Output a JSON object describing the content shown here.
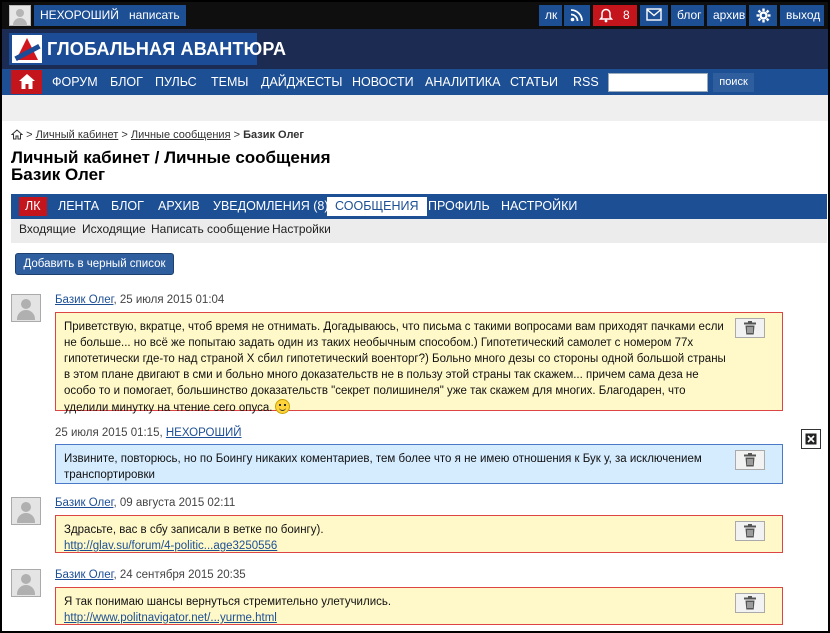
{
  "topbar": {
    "user_name": "НЕХОРОШИЙ",
    "write_label": "написать",
    "lk_label": "лк",
    "notifications_count": "8",
    "blog_label": "блог",
    "archive_label": "архив",
    "exit_label": "выход"
  },
  "logo": {
    "text": "ГЛОБАЛЬНАЯ АВАНТЮРА"
  },
  "main_nav": {
    "items": [
      "ФОРУМ",
      "БЛОГ",
      "ПУЛЬС",
      "ТЕМЫ",
      "ДАЙДЖЕСТЫ",
      "НОВОСТИ",
      "АНАЛИТИКА",
      "СТАТЬИ",
      "RSS"
    ],
    "search_value": "",
    "search_button": "поиск"
  },
  "breadcrumb": {
    "sep": ">",
    "link1": "Личный кабинет",
    "link2": "Личные сообщения",
    "current": "Базик Олег"
  },
  "page_title": "Личный кабинет / Личные сообщения",
  "page_subtitle": "Базик Олег",
  "cabinet_nav": {
    "items": [
      "ЛК",
      "ЛЕНТА",
      "БЛОГ",
      "АРХИВ",
      "УВЕДОМЛЕНИЯ (8)",
      "СООБЩЕНИЯ",
      "ПРОФИЛЬ",
      "НАСТРОЙКИ"
    ]
  },
  "sub_nav": {
    "items": [
      "Входящие",
      "Исходящие",
      "Написать сообщение",
      "Настройки"
    ]
  },
  "blacklist_button": "Добавить в черный список",
  "messages": [
    {
      "author": "Базик Олег",
      "date": ", 25 июля 2015 01:04",
      "text": "Приветствую, вкратце, чтоб время не отнимать. Догадываюсь, что письма с такими вопросами вам приходят пачками если не больше... но всё же попытаю задать один из таких необычным способом.) Гипотетический самолет с номером 77х гипотетически где-то над страной Х сбил гипотетический военторг?) Больно много дезы со стороны одной большой страны в этом плане двигают в сми и больно много доказательств не в пользу этой страны так скажем... причем сама деза не особо то и помогает, большинство доказательств \"секрет полишинеля\" уже так скажем для многих. Благодарен, что уделили минутку на чтение сего опуса."
    },
    {
      "author": "НЕХОРОШИЙ",
      "date": "25 июля 2015 01:15, ",
      "text": "Извините, повторюсь, но по Боингу никаких коментариев, тем более что я не имею отношения к Бук у, за исключением транспортировки"
    },
    {
      "author": "Базик Олег",
      "date": ", 09 августа 2015 02:11",
      "text": "Здрасьте, вас в сбу записали в ветке по боингу).",
      "link": "http://glav.su/forum/4-politic...age3250556"
    },
    {
      "author": "Базик Олег",
      "date": ", 24 сентября 2015 20:35",
      "text": "Я так понимаю шансы вернуться стремительно улетучились.",
      "link": "http://www.politnavigator.net/...yurme.html"
    }
  ],
  "colors": {
    "nav_blue": "#1d4f95",
    "accent_red": "#c4151c",
    "incoming_bg": "#fff9c9",
    "outgoing_bg": "#d5ecff"
  }
}
